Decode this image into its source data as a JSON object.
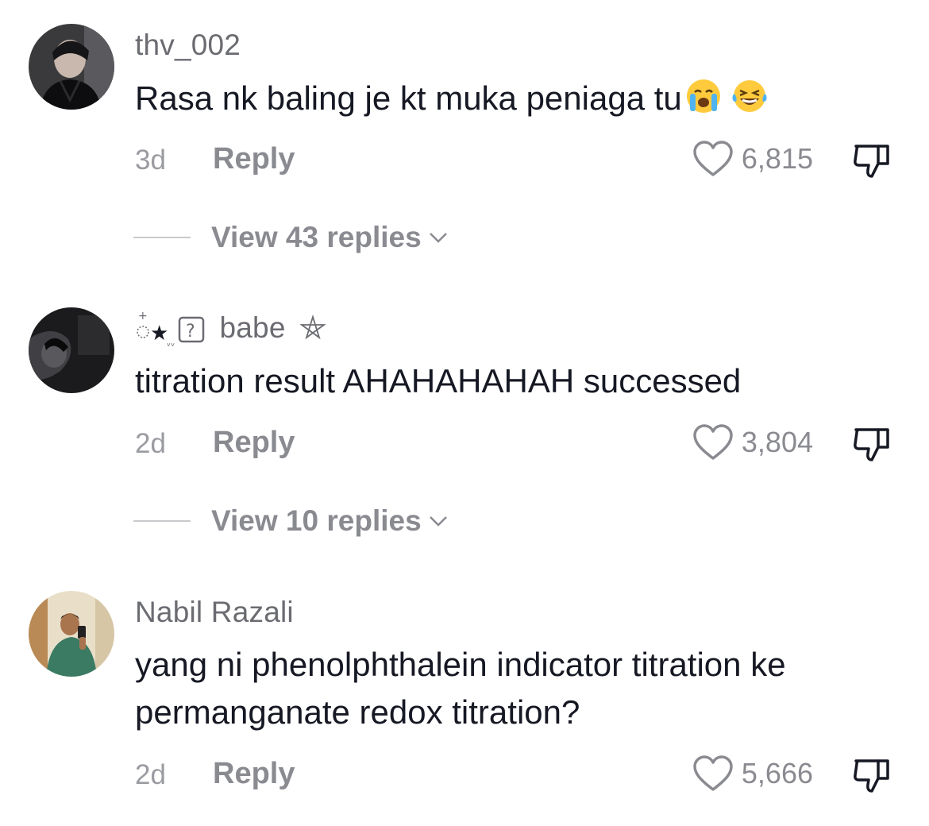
{
  "comments": [
    {
      "username": "thv_002",
      "text": "Rasa nk baling je kt muka peniaga tu",
      "emojis": [
        "loudly-crying-face-emoji",
        "face-with-tears-of-joy-emoji"
      ],
      "time": "3d",
      "reply_label": "Reply",
      "likes": "6,815",
      "view_replies": "View 43 replies"
    },
    {
      "username_prefix_symbols": "★",
      "username": "babe",
      "text": "titration result AHAHAHAHAH successed",
      "time": "2d",
      "reply_label": "Reply",
      "likes": "3,804",
      "view_replies": "View 10 replies"
    },
    {
      "username": "Nabil Razali",
      "text_line1": "yang ni phenolphthalein indicator titration ke",
      "text_line2": "permanganate redox titration?",
      "time": "2d",
      "reply_label": "Reply",
      "likes": "5,666"
    }
  ],
  "icons": {
    "like": "heart-outline-icon",
    "dislike": "thumbs-down-icon",
    "expand": "chevron-down-icon"
  },
  "colors": {
    "text": "#161823",
    "username": "#6b6c72",
    "secondary": "#8a8b91"
  }
}
